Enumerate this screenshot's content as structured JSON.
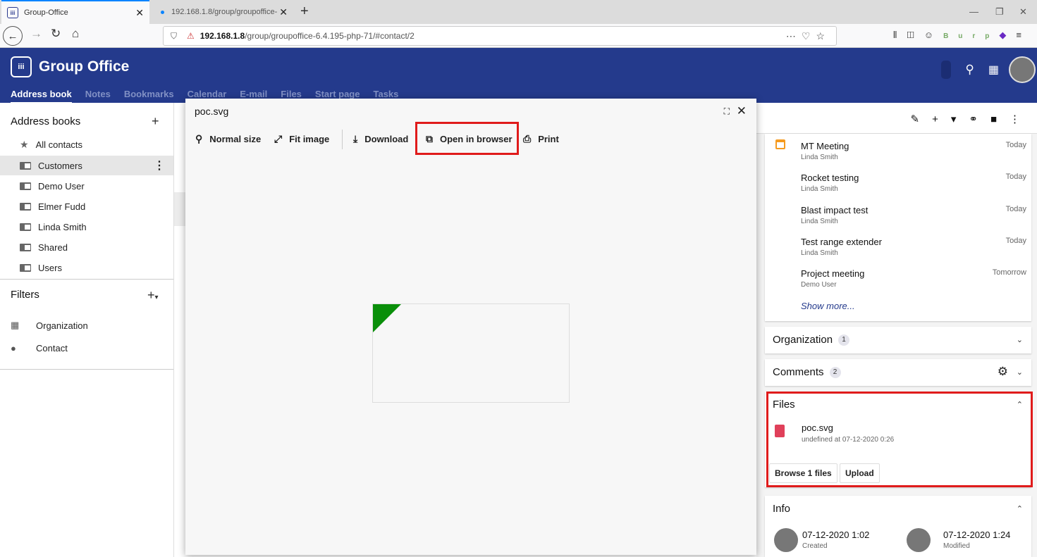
{
  "browser": {
    "active_tab_title": "Group-Office",
    "inactive_tab_title": "192.168.1.8/group/groupoffice-",
    "url_host": "192.168.1.8",
    "url_path": "/group/groupoffice-6.4.195-php-71/#contact/2",
    "burp_label": "Burp"
  },
  "app": {
    "title": "Group Office",
    "logo_glyph": "iii",
    "tabs": [
      "Address book",
      "Notes",
      "Bookmarks",
      "Calendar",
      "E-mail",
      "Files",
      "Start page",
      "Tasks"
    ]
  },
  "sidebar": {
    "address_books_heading": "Address books",
    "items": [
      "All contacts",
      "Customers",
      "Demo User",
      "Elmer Fudd",
      "Linda Smith",
      "Shared",
      "Users"
    ],
    "filters_heading": "Filters",
    "filters": [
      "Organization",
      "Contact"
    ]
  },
  "modal": {
    "title": "poc.svg",
    "buttons": {
      "normal_size": "Normal size",
      "fit_image": "Fit image",
      "download": "Download",
      "open_in_browser": "Open in browser",
      "print": "Print"
    }
  },
  "right_panel": {
    "events": [
      {
        "title": "MT Meeting",
        "person": "Linda Smith",
        "when": "Today"
      },
      {
        "title": "Rocket testing",
        "person": "Linda Smith",
        "when": "Today"
      },
      {
        "title": "Blast impact test",
        "person": "Linda Smith",
        "when": "Today"
      },
      {
        "title": "Test range extender",
        "person": "Linda Smith",
        "when": "Today"
      },
      {
        "title": "Project meeting",
        "person": "Demo User",
        "when": "Tomorrow"
      }
    ],
    "show_more": "Show more...",
    "organization": {
      "title": "Organization",
      "count": "1"
    },
    "comments": {
      "title": "Comments",
      "count": "2"
    },
    "files": {
      "title": "Files",
      "file_name": "poc.svg",
      "file_meta": "undefined at 07-12-2020 0:26",
      "browse_button": "Browse 1 files",
      "upload_button": "Upload"
    },
    "info": {
      "title": "Info",
      "created_date": "07-12-2020 1:02",
      "created_label": "Created",
      "modified_date": "07-12-2020 1:24",
      "modified_label": "Modified"
    }
  },
  "colors": {
    "header_bg": "#243a8c",
    "highlight_red": "#e01b1b",
    "svg_triangle": "#0a8f0a"
  }
}
